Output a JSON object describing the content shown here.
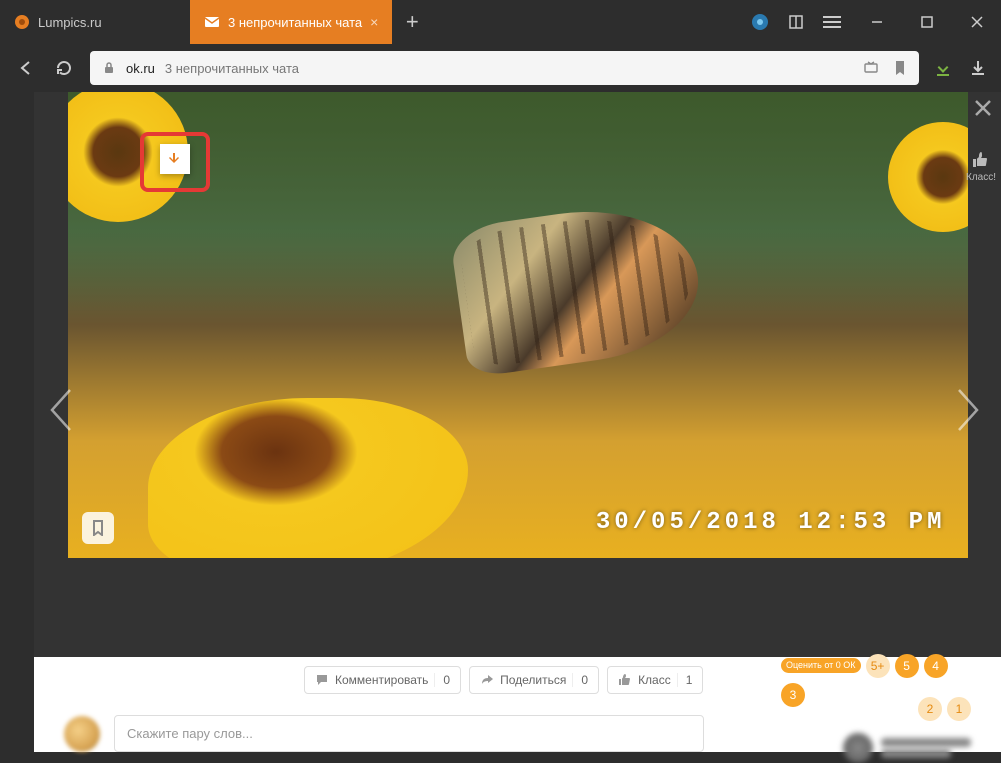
{
  "browser": {
    "tabs": [
      {
        "label": "Lumpics.ru",
        "active": false
      },
      {
        "label": "3 непрочитанных чата",
        "active": true
      }
    ],
    "url_domain": "ok.ru",
    "url_title": "3 непрочитанных чата"
  },
  "photo": {
    "watermark": "30/05/2018  12:53  PM"
  },
  "overlay": {
    "klass_label": "Класс!"
  },
  "actions": {
    "comment_label": "Комментировать",
    "comment_count": "0",
    "share_label": "Поделиться",
    "share_count": "0",
    "klass_label": "Класс",
    "klass_count": "1"
  },
  "ratings": {
    "label": "Оценить от 0 ОК",
    "values": [
      "5+",
      "5",
      "4",
      "3",
      "2",
      "1"
    ]
  },
  "comment_placeholder": "Скажите пару слов..."
}
